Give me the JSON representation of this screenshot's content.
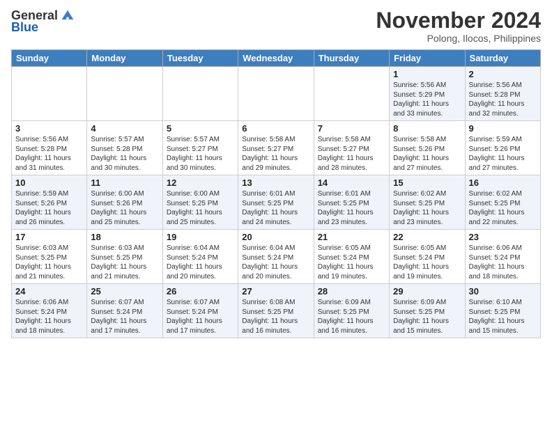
{
  "logo": {
    "general": "General",
    "blue": "Blue"
  },
  "title": "November 2024",
  "location": "Polong, Ilocos, Philippines",
  "days_of_week": [
    "Sunday",
    "Monday",
    "Tuesday",
    "Wednesday",
    "Thursday",
    "Friday",
    "Saturday"
  ],
  "weeks": [
    [
      {
        "day": "",
        "sunrise": "",
        "sunset": "",
        "daylight": ""
      },
      {
        "day": "",
        "sunrise": "",
        "sunset": "",
        "daylight": ""
      },
      {
        "day": "",
        "sunrise": "",
        "sunset": "",
        "daylight": ""
      },
      {
        "day": "",
        "sunrise": "",
        "sunset": "",
        "daylight": ""
      },
      {
        "day": "",
        "sunrise": "",
        "sunset": "",
        "daylight": ""
      },
      {
        "day": "1",
        "sunrise": "Sunrise: 5:56 AM",
        "sunset": "Sunset: 5:29 PM",
        "daylight": "Daylight: 11 hours and 33 minutes."
      },
      {
        "day": "2",
        "sunrise": "Sunrise: 5:56 AM",
        "sunset": "Sunset: 5:28 PM",
        "daylight": "Daylight: 11 hours and 32 minutes."
      }
    ],
    [
      {
        "day": "3",
        "sunrise": "Sunrise: 5:56 AM",
        "sunset": "Sunset: 5:28 PM",
        "daylight": "Daylight: 11 hours and 31 minutes."
      },
      {
        "day": "4",
        "sunrise": "Sunrise: 5:57 AM",
        "sunset": "Sunset: 5:28 PM",
        "daylight": "Daylight: 11 hours and 30 minutes."
      },
      {
        "day": "5",
        "sunrise": "Sunrise: 5:57 AM",
        "sunset": "Sunset: 5:27 PM",
        "daylight": "Daylight: 11 hours and 30 minutes."
      },
      {
        "day": "6",
        "sunrise": "Sunrise: 5:58 AM",
        "sunset": "Sunset: 5:27 PM",
        "daylight": "Daylight: 11 hours and 29 minutes."
      },
      {
        "day": "7",
        "sunrise": "Sunrise: 5:58 AM",
        "sunset": "Sunset: 5:27 PM",
        "daylight": "Daylight: 11 hours and 28 minutes."
      },
      {
        "day": "8",
        "sunrise": "Sunrise: 5:58 AM",
        "sunset": "Sunset: 5:26 PM",
        "daylight": "Daylight: 11 hours and 27 minutes."
      },
      {
        "day": "9",
        "sunrise": "Sunrise: 5:59 AM",
        "sunset": "Sunset: 5:26 PM",
        "daylight": "Daylight: 11 hours and 27 minutes."
      }
    ],
    [
      {
        "day": "10",
        "sunrise": "Sunrise: 5:59 AM",
        "sunset": "Sunset: 5:26 PM",
        "daylight": "Daylight: 11 hours and 26 minutes."
      },
      {
        "day": "11",
        "sunrise": "Sunrise: 6:00 AM",
        "sunset": "Sunset: 5:26 PM",
        "daylight": "Daylight: 11 hours and 25 minutes."
      },
      {
        "day": "12",
        "sunrise": "Sunrise: 6:00 AM",
        "sunset": "Sunset: 5:25 PM",
        "daylight": "Daylight: 11 hours and 25 minutes."
      },
      {
        "day": "13",
        "sunrise": "Sunrise: 6:01 AM",
        "sunset": "Sunset: 5:25 PM",
        "daylight": "Daylight: 11 hours and 24 minutes."
      },
      {
        "day": "14",
        "sunrise": "Sunrise: 6:01 AM",
        "sunset": "Sunset: 5:25 PM",
        "daylight": "Daylight: 11 hours and 23 minutes."
      },
      {
        "day": "15",
        "sunrise": "Sunrise: 6:02 AM",
        "sunset": "Sunset: 5:25 PM",
        "daylight": "Daylight: 11 hours and 23 minutes."
      },
      {
        "day": "16",
        "sunrise": "Sunrise: 6:02 AM",
        "sunset": "Sunset: 5:25 PM",
        "daylight": "Daylight: 11 hours and 22 minutes."
      }
    ],
    [
      {
        "day": "17",
        "sunrise": "Sunrise: 6:03 AM",
        "sunset": "Sunset: 5:25 PM",
        "daylight": "Daylight: 11 hours and 21 minutes."
      },
      {
        "day": "18",
        "sunrise": "Sunrise: 6:03 AM",
        "sunset": "Sunset: 5:25 PM",
        "daylight": "Daylight: 11 hours and 21 minutes."
      },
      {
        "day": "19",
        "sunrise": "Sunrise: 6:04 AM",
        "sunset": "Sunset: 5:24 PM",
        "daylight": "Daylight: 11 hours and 20 minutes."
      },
      {
        "day": "20",
        "sunrise": "Sunrise: 6:04 AM",
        "sunset": "Sunset: 5:24 PM",
        "daylight": "Daylight: 11 hours and 20 minutes."
      },
      {
        "day": "21",
        "sunrise": "Sunrise: 6:05 AM",
        "sunset": "Sunset: 5:24 PM",
        "daylight": "Daylight: 11 hours and 19 minutes."
      },
      {
        "day": "22",
        "sunrise": "Sunrise: 6:05 AM",
        "sunset": "Sunset: 5:24 PM",
        "daylight": "Daylight: 11 hours and 19 minutes."
      },
      {
        "day": "23",
        "sunrise": "Sunrise: 6:06 AM",
        "sunset": "Sunset: 5:24 PM",
        "daylight": "Daylight: 11 hours and 18 minutes."
      }
    ],
    [
      {
        "day": "24",
        "sunrise": "Sunrise: 6:06 AM",
        "sunset": "Sunset: 5:24 PM",
        "daylight": "Daylight: 11 hours and 18 minutes."
      },
      {
        "day": "25",
        "sunrise": "Sunrise: 6:07 AM",
        "sunset": "Sunset: 5:24 PM",
        "daylight": "Daylight: 11 hours and 17 minutes."
      },
      {
        "day": "26",
        "sunrise": "Sunrise: 6:07 AM",
        "sunset": "Sunset: 5:24 PM",
        "daylight": "Daylight: 11 hours and 17 minutes."
      },
      {
        "day": "27",
        "sunrise": "Sunrise: 6:08 AM",
        "sunset": "Sunset: 5:25 PM",
        "daylight": "Daylight: 11 hours and 16 minutes."
      },
      {
        "day": "28",
        "sunrise": "Sunrise: 6:09 AM",
        "sunset": "Sunset: 5:25 PM",
        "daylight": "Daylight: 11 hours and 16 minutes."
      },
      {
        "day": "29",
        "sunrise": "Sunrise: 6:09 AM",
        "sunset": "Sunset: 5:25 PM",
        "daylight": "Daylight: 11 hours and 15 minutes."
      },
      {
        "day": "30",
        "sunrise": "Sunrise: 6:10 AM",
        "sunset": "Sunset: 5:25 PM",
        "daylight": "Daylight: 11 hours and 15 minutes."
      }
    ]
  ]
}
